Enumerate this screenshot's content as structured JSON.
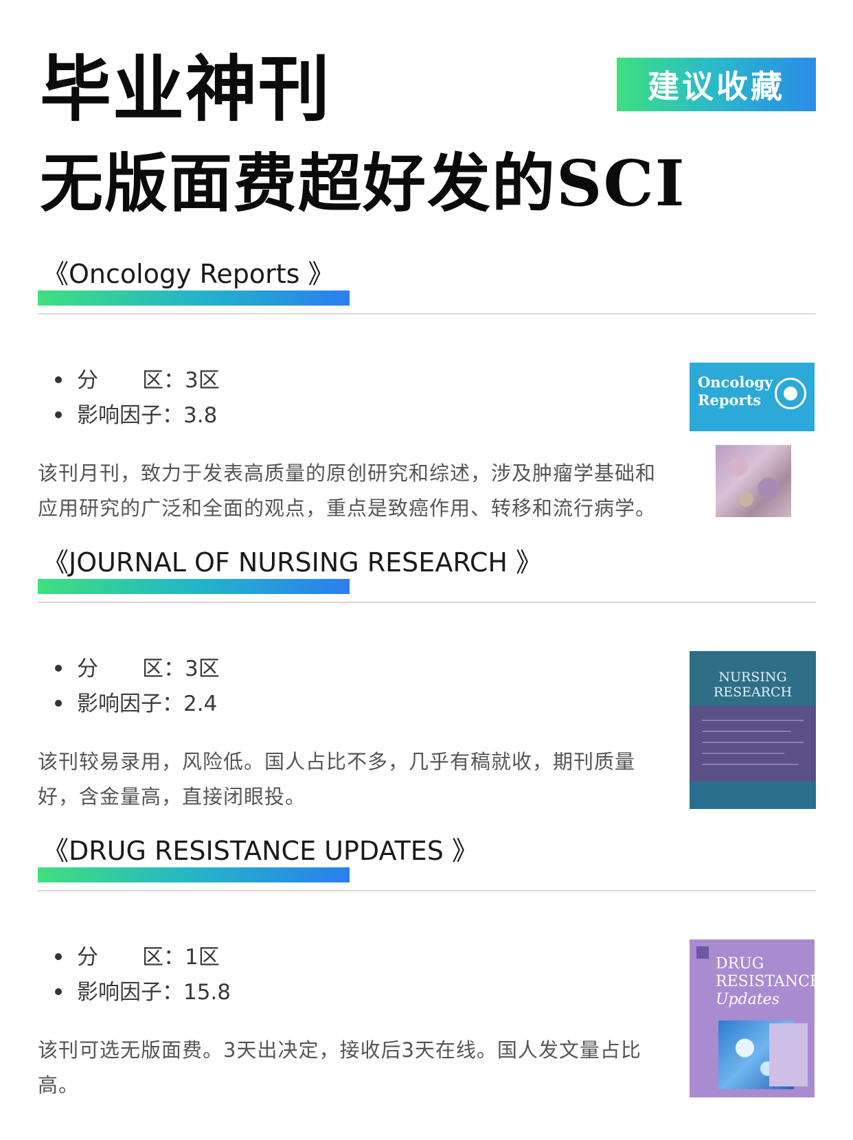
{
  "header": {
    "title_line1": "毕业神刊",
    "title_line2": "无版面费超好发的SCI",
    "badge": "建议收藏"
  },
  "journals": [
    {
      "name": "《Oncology Reports 》",
      "stats": [
        {
          "label": "分",
          "label2": "区：",
          "value": "3区"
        },
        {
          "label": "影响因子：",
          "value": "3.8"
        }
      ],
      "description": "该刊月刊，致力于发表高质量的原创研究和综述，涉及肿瘤学基础和应用研究的广泛和全面的观点，重点是致癌作用、转移和流行病学。",
      "cover_text": [
        "Oncology",
        "Reports"
      ]
    },
    {
      "name": "《JOURNAL OF NURSING RESEARCH 》",
      "stats": [
        {
          "label": "分",
          "label2": "区：",
          "value": "3区"
        },
        {
          "label": "影响因子：",
          "value": "2.4"
        }
      ],
      "description": "该刊较易录用，风险低。国人占比不多，几乎有稿就收，期刊质量好，含金量高，直接闭眼投。",
      "cover_text": [
        "NURSING",
        "RESEARCH"
      ]
    },
    {
      "name": "《DRUG RESISTANCE UPDATES 》",
      "stats": [
        {
          "label": "分",
          "label2": "区：",
          "value": "1区"
        },
        {
          "label": "影响因子：",
          "value": "15.8"
        }
      ],
      "description": "该刊可选无版面费。3天出决定，接收后3天在线。国人发文量占比高。",
      "cover_text": [
        "DRUG",
        "RESISTANCE",
        "Updates"
      ]
    }
  ]
}
